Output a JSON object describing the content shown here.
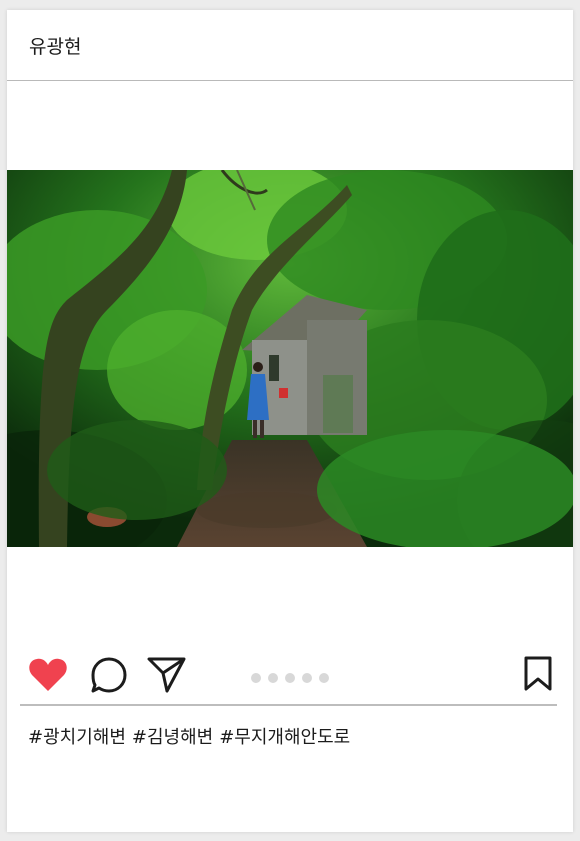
{
  "post": {
    "username": "유광현",
    "hashtags": [
      "#광치기해변",
      "#김녕해변",
      "#무지개해안도로"
    ],
    "carousel_dot_count": 5
  },
  "icons": {
    "like": "heart-icon",
    "comment": "speech-bubble-icon",
    "share": "paper-plane-icon",
    "save": "bookmark-icon"
  },
  "colors": {
    "like_red": "#f0424f",
    "icon_dark": "#1c1c1c",
    "dot_gray": "#d8d8d8"
  }
}
